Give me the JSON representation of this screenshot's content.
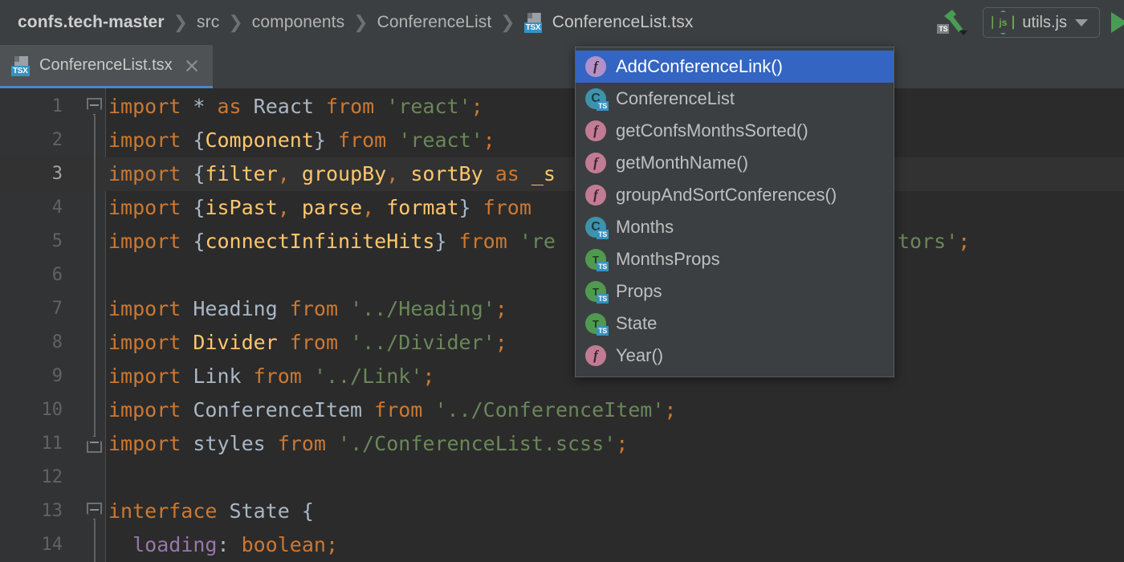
{
  "window": {
    "breadcrumb": {
      "root": "confs.tech-master",
      "items": [
        "src",
        "components",
        "ConferenceList"
      ],
      "file": "ConferenceList.tsx",
      "file_icon": "tsx-file-icon",
      "separator": "❯"
    },
    "toolbar": {
      "build_icon": "hammer-build-icon",
      "build_badge": "TS",
      "run_config": "utils.js",
      "run_config_icon": "nodejs-icon",
      "run_config_caret": "chevron-down-icon",
      "run_button_icon": "run-play-icon"
    }
  },
  "tabs": [
    {
      "label": "ConferenceList.tsx",
      "icon": "tsx-file-icon",
      "close_icon": "close-icon",
      "active": true
    }
  ],
  "editor": {
    "current_line": 3,
    "lines": [
      {
        "n": 1,
        "fold": "start",
        "tokens": [
          [
            "kw",
            "import"
          ],
          [
            "plain",
            " "
          ],
          [
            "plain",
            "*"
          ],
          [
            "plain",
            " "
          ],
          [
            "kw",
            "as"
          ],
          [
            "plain",
            " "
          ],
          [
            "id",
            "React"
          ],
          [
            "plain",
            " "
          ],
          [
            "kw",
            "from"
          ],
          [
            "plain",
            " "
          ],
          [
            "str",
            "'react'"
          ],
          [
            "kw",
            ";"
          ]
        ]
      },
      {
        "n": 2,
        "fold": "line",
        "tokens": [
          [
            "kw",
            "import"
          ],
          [
            "plain",
            " "
          ],
          [
            "brace",
            "{"
          ],
          [
            "imp",
            "Component"
          ],
          [
            "brace",
            "}"
          ],
          [
            "plain",
            " "
          ],
          [
            "kw",
            "from"
          ],
          [
            "plain",
            " "
          ],
          [
            "str",
            "'react'"
          ],
          [
            "kw",
            ";"
          ]
        ]
      },
      {
        "n": 3,
        "fold": "line",
        "tokens": [
          [
            "kw",
            "import"
          ],
          [
            "plain",
            " "
          ],
          [
            "brace",
            "{"
          ],
          [
            "imp",
            "filter"
          ],
          [
            "kw",
            ", "
          ],
          [
            "imp",
            "groupBy"
          ],
          [
            "kw",
            ", "
          ],
          [
            "imp",
            "sortBy"
          ],
          [
            "plain",
            " "
          ],
          [
            "kw",
            "as"
          ],
          [
            "plain",
            " "
          ],
          [
            "imp",
            "_s"
          ]
        ]
      },
      {
        "n": 4,
        "fold": "line",
        "tokens": [
          [
            "kw",
            "import"
          ],
          [
            "plain",
            " "
          ],
          [
            "brace",
            "{"
          ],
          [
            "imp",
            "isPast"
          ],
          [
            "kw",
            ", "
          ],
          [
            "imp",
            "parse"
          ],
          [
            "kw",
            ", "
          ],
          [
            "imp",
            "format"
          ],
          [
            "brace",
            "}"
          ],
          [
            "plain",
            " "
          ],
          [
            "kw",
            "from"
          ]
        ]
      },
      {
        "n": 5,
        "fold": "line",
        "tokens": [
          [
            "kw",
            "import"
          ],
          [
            "plain",
            " "
          ],
          [
            "brace",
            "{"
          ],
          [
            "imp",
            "connectInfiniteHits"
          ],
          [
            "brace",
            "}"
          ],
          [
            "plain",
            " "
          ],
          [
            "kw",
            "from"
          ],
          [
            "plain",
            " "
          ],
          [
            "str",
            "'re"
          ]
        ]
      },
      {
        "n": 6,
        "fold": "line",
        "tokens": []
      },
      {
        "n": 7,
        "fold": "line",
        "tokens": [
          [
            "kw",
            "import"
          ],
          [
            "plain",
            " "
          ],
          [
            "id",
            "Heading"
          ],
          [
            "plain",
            " "
          ],
          [
            "kw",
            "from"
          ],
          [
            "plain",
            " "
          ],
          [
            "str",
            "'../Heading'"
          ],
          [
            "kw",
            ";"
          ]
        ]
      },
      {
        "n": 8,
        "fold": "line",
        "tokens": [
          [
            "kw",
            "import"
          ],
          [
            "plain",
            " "
          ],
          [
            "imp",
            "Divider"
          ],
          [
            "plain",
            " "
          ],
          [
            "kw",
            "from"
          ],
          [
            "plain",
            " "
          ],
          [
            "str",
            "'../Divider'"
          ],
          [
            "kw",
            ";"
          ]
        ]
      },
      {
        "n": 9,
        "fold": "line",
        "tokens": [
          [
            "kw",
            "import"
          ],
          [
            "plain",
            " "
          ],
          [
            "id",
            "Link"
          ],
          [
            "plain",
            " "
          ],
          [
            "kw",
            "from"
          ],
          [
            "plain",
            " "
          ],
          [
            "str",
            "'../Link'"
          ],
          [
            "kw",
            ";"
          ]
        ]
      },
      {
        "n": 10,
        "fold": "line",
        "tokens": [
          [
            "kw",
            "import"
          ],
          [
            "plain",
            " "
          ],
          [
            "id",
            "ConferenceItem"
          ],
          [
            "plain",
            " "
          ],
          [
            "kw",
            "from"
          ],
          [
            "plain",
            " "
          ],
          [
            "str",
            "'../ConferenceItem'"
          ],
          [
            "kw",
            ";"
          ]
        ]
      },
      {
        "n": 11,
        "fold": "end",
        "tokens": [
          [
            "kw",
            "import"
          ],
          [
            "plain",
            " "
          ],
          [
            "id",
            "styles"
          ],
          [
            "plain",
            " "
          ],
          [
            "kw",
            "from"
          ],
          [
            "plain",
            " "
          ],
          [
            "str",
            "'./ConferenceList.scss'"
          ],
          [
            "kw",
            ";"
          ]
        ]
      },
      {
        "n": 12,
        "fold": "none",
        "tokens": []
      },
      {
        "n": 13,
        "fold": "start2",
        "tokens": [
          [
            "kw",
            "interface"
          ],
          [
            "plain",
            " "
          ],
          [
            "id",
            "State"
          ],
          [
            "plain",
            " "
          ],
          [
            "plain",
            "{"
          ]
        ]
      },
      {
        "n": 14,
        "fold": "none",
        "tokens": [
          [
            "plain",
            "  "
          ],
          [
            "fld",
            "loading"
          ],
          [
            "plain",
            ": "
          ],
          [
            "kw",
            "boolean"
          ],
          [
            "kw",
            ";"
          ]
        ]
      }
    ],
    "line5_tail": {
      "text": "tors';",
      "prefix_color": "#6a8759"
    }
  },
  "completion_popup": {
    "items": [
      {
        "label": "AddConferenceLink()",
        "icon": "function-icon",
        "kind": "fn",
        "selected": true
      },
      {
        "label": "ConferenceList",
        "icon": "class-ts-icon",
        "kind": "cls",
        "glyph": "C",
        "selected": false
      },
      {
        "label": "getConfsMonthsSorted()",
        "icon": "function-icon",
        "kind": "fn",
        "selected": false
      },
      {
        "label": "getMonthName()",
        "icon": "function-icon",
        "kind": "fn",
        "selected": false
      },
      {
        "label": "groupAndSortConferences()",
        "icon": "function-icon",
        "kind": "fn",
        "selected": false
      },
      {
        "label": "Months",
        "icon": "class-ts-icon",
        "kind": "cls",
        "glyph": "C",
        "selected": false
      },
      {
        "label": "MonthsProps",
        "icon": "type-ts-icon",
        "kind": "typ",
        "glyph": "T",
        "selected": false
      },
      {
        "label": "Props",
        "icon": "type-ts-icon",
        "kind": "typ",
        "glyph": "T",
        "selected": false
      },
      {
        "label": "State",
        "icon": "type-ts-icon",
        "kind": "typ",
        "glyph": "T",
        "selected": false
      },
      {
        "label": "Year()",
        "icon": "function-icon",
        "kind": "fn",
        "selected": false
      }
    ],
    "function_glyph": "f",
    "ts_badge": "TS"
  },
  "colors": {
    "selection_blue": "#3465c2",
    "keyword_orange": "#cc7832",
    "string_green": "#6a8759",
    "identifier_blue_grey": "#a9b7c6",
    "import_yellow": "#ffc66d",
    "field_purple": "#9876aa",
    "editor_bg": "#2b2b2b",
    "chrome_bg": "#3c3f41",
    "tab_active_underline": "#4a88c7",
    "run_green": "#499c54"
  }
}
